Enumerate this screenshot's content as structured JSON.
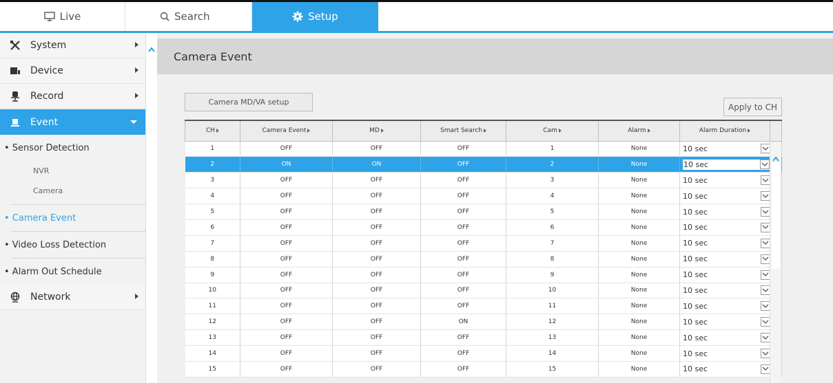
{
  "nav": {
    "tabs": [
      {
        "label": "Live",
        "icon": "monitor-icon"
      },
      {
        "label": "Search",
        "icon": "search-icon"
      },
      {
        "label": "Setup",
        "icon": "gear-icon",
        "active": true
      }
    ]
  },
  "sidebar": {
    "items": [
      {
        "label": "System",
        "icon": "tools-icon"
      },
      {
        "label": "Device",
        "icon": "device-icon"
      },
      {
        "label": "Record",
        "icon": "record-icon"
      },
      {
        "label": "Event",
        "icon": "event-icon",
        "active": true
      },
      {
        "label": "Network",
        "icon": "globe-icon"
      }
    ],
    "event_sub": {
      "sensor_detection": "• Sensor Detection",
      "nvr": "NVR",
      "camera": "Camera",
      "camera_event": "• Camera Event",
      "video_loss": "• Video Loss Detection",
      "alarm_out": "• Alarm Out Schedule"
    }
  },
  "page": {
    "title": "Camera Event",
    "setup_button": "Camera MD/VA setup",
    "apply_button": "Apply to CH"
  },
  "table": {
    "columns": [
      "CH",
      "Camera Event",
      "MD",
      "Smart Search",
      "Cam",
      "Alarm",
      "Alarm Duration"
    ],
    "rows": [
      {
        "ch": "1",
        "event": "OFF",
        "md": "OFF",
        "smart": "OFF",
        "cam": "1",
        "alarm": "None",
        "duration": "10 sec"
      },
      {
        "ch": "2",
        "event": "ON",
        "md": "ON",
        "smart": "OFF",
        "cam": "2",
        "alarm": "None",
        "duration": "10 sec",
        "selected": true
      },
      {
        "ch": "3",
        "event": "OFF",
        "md": "OFF",
        "smart": "OFF",
        "cam": "3",
        "alarm": "None",
        "duration": "10 sec"
      },
      {
        "ch": "4",
        "event": "OFF",
        "md": "OFF",
        "smart": "OFF",
        "cam": "4",
        "alarm": "None",
        "duration": "10 sec"
      },
      {
        "ch": "5",
        "event": "OFF",
        "md": "OFF",
        "smart": "OFF",
        "cam": "5",
        "alarm": "None",
        "duration": "10 sec"
      },
      {
        "ch": "6",
        "event": "OFF",
        "md": "OFF",
        "smart": "OFF",
        "cam": "6",
        "alarm": "None",
        "duration": "10 sec"
      },
      {
        "ch": "7",
        "event": "OFF",
        "md": "OFF",
        "smart": "OFF",
        "cam": "7",
        "alarm": "None",
        "duration": "10 sec"
      },
      {
        "ch": "8",
        "event": "OFF",
        "md": "OFF",
        "smart": "OFF",
        "cam": "8",
        "alarm": "None",
        "duration": "10 sec"
      },
      {
        "ch": "9",
        "event": "OFF",
        "md": "OFF",
        "smart": "OFF",
        "cam": "9",
        "alarm": "None",
        "duration": "10 sec"
      },
      {
        "ch": "10",
        "event": "OFF",
        "md": "OFF",
        "smart": "OFF",
        "cam": "10",
        "alarm": "None",
        "duration": "10 sec"
      },
      {
        "ch": "11",
        "event": "OFF",
        "md": "OFF",
        "smart": "OFF",
        "cam": "11",
        "alarm": "None",
        "duration": "10 sec"
      },
      {
        "ch": "12",
        "event": "OFF",
        "md": "OFF",
        "smart": "ON",
        "cam": "12",
        "alarm": "None",
        "duration": "10 sec"
      },
      {
        "ch": "13",
        "event": "OFF",
        "md": "OFF",
        "smart": "OFF",
        "cam": "13",
        "alarm": "None",
        "duration": "10 sec"
      },
      {
        "ch": "14",
        "event": "OFF",
        "md": "OFF",
        "smart": "OFF",
        "cam": "14",
        "alarm": "None",
        "duration": "10 sec"
      },
      {
        "ch": "15",
        "event": "OFF",
        "md": "OFF",
        "smart": "OFF",
        "cam": "15",
        "alarm": "None",
        "duration": "10 sec"
      }
    ]
  },
  "colors": {
    "accent": "#2ea3e8"
  }
}
